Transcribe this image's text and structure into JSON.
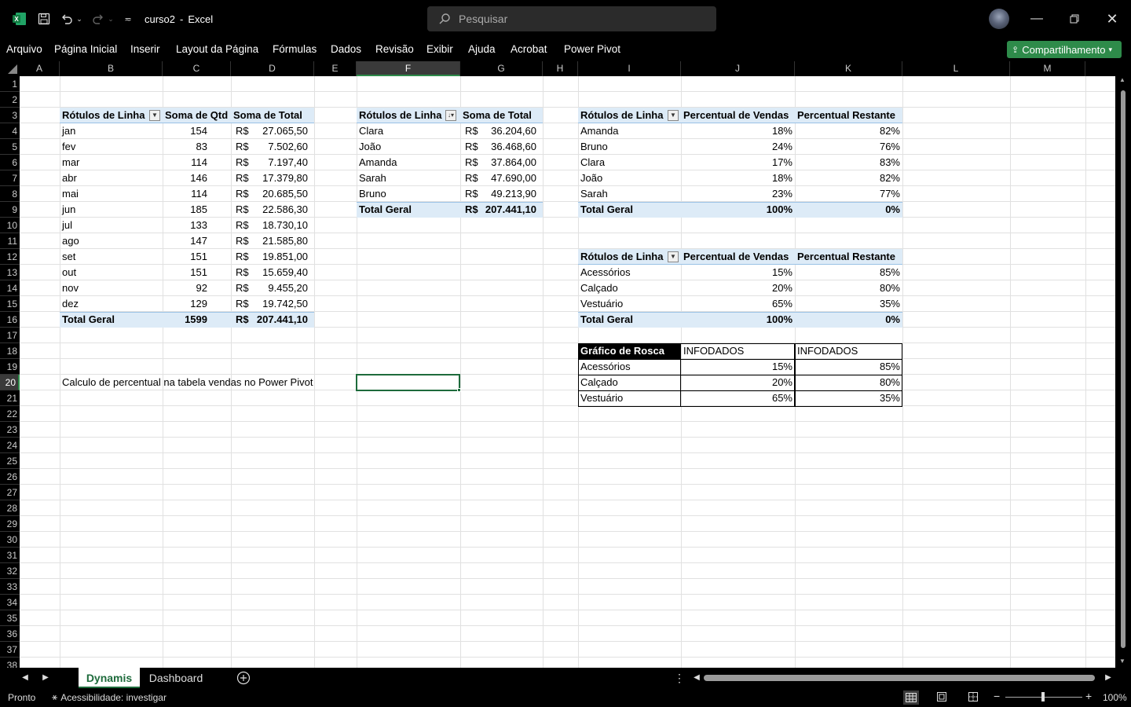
{
  "app": {
    "filename": "curso2",
    "separator": "-",
    "appname": "Excel"
  },
  "search": {
    "placeholder": "Pesquisar"
  },
  "menu": [
    "Arquivo",
    "Página Inicial",
    "Inserir",
    "Layout da Página",
    "Fórmulas",
    "Dados",
    "Revisão",
    "Exibir",
    "Ajuda",
    "Acrobat",
    "Power Pivot"
  ],
  "share_label": "Compartilhamento",
  "columns": [
    "A",
    "B",
    "C",
    "D",
    "E",
    "F",
    "G",
    "H",
    "I",
    "J",
    "K",
    "L",
    "M"
  ],
  "rows": [
    "1",
    "2",
    "3",
    "4",
    "5",
    "6",
    "7",
    "8",
    "9",
    "10",
    "11",
    "12",
    "13",
    "14",
    "15",
    "16",
    "17",
    "18",
    "19",
    "20",
    "21",
    "22",
    "23",
    "24",
    "25",
    "26",
    "27",
    "28",
    "29",
    "30",
    "31",
    "32",
    "33",
    "34",
    "35",
    "36",
    "37",
    "38"
  ],
  "pivot1": {
    "headers": [
      "Rótulos de Linha",
      "Soma de Qtd",
      "Soma de Total"
    ],
    "rows": [
      [
        "jan",
        "154",
        "R$",
        "27.065,50"
      ],
      [
        "fev",
        "83",
        "R$",
        "7.502,60"
      ],
      [
        "mar",
        "114",
        "R$",
        "7.197,40"
      ],
      [
        "abr",
        "146",
        "R$",
        "17.379,80"
      ],
      [
        "mai",
        "114",
        "R$",
        "20.685,50"
      ],
      [
        "jun",
        "185",
        "R$",
        "22.586,30"
      ],
      [
        "jul",
        "133",
        "R$",
        "18.730,10"
      ],
      [
        "ago",
        "147",
        "R$",
        "21.585,80"
      ],
      [
        "set",
        "151",
        "R$",
        "19.851,00"
      ],
      [
        "out",
        "151",
        "R$",
        "15.659,40"
      ],
      [
        "nov",
        "92",
        "R$",
        "9.455,20"
      ],
      [
        "dez",
        "129",
        "R$",
        "19.742,50"
      ]
    ],
    "total": [
      "Total Geral",
      "1599",
      "R$",
      "207.441,10"
    ]
  },
  "pivot2": {
    "headers": [
      "Rótulos de Linha",
      "Soma de Total"
    ],
    "rows": [
      [
        "Clara",
        "R$",
        "36.204,60"
      ],
      [
        "João",
        "R$",
        "36.468,60"
      ],
      [
        "Amanda",
        "R$",
        "37.864,00"
      ],
      [
        "Sarah",
        "R$",
        "47.690,00"
      ],
      [
        "Bruno",
        "R$",
        "49.213,90"
      ]
    ],
    "total": [
      "Total Geral",
      "R$",
      "207.441,10"
    ]
  },
  "pivot3": {
    "headers": [
      "Rótulos de Linha",
      "Percentual de Vendas",
      "Percentual Restante"
    ],
    "rows": [
      [
        "Amanda",
        "18%",
        "82%"
      ],
      [
        "Bruno",
        "24%",
        "76%"
      ],
      [
        "Clara",
        "17%",
        "83%"
      ],
      [
        "João",
        "18%",
        "82%"
      ],
      [
        "Sarah",
        "23%",
        "77%"
      ]
    ],
    "total": [
      "Total Geral",
      "100%",
      "0%"
    ]
  },
  "pivot4": {
    "headers": [
      "Rótulos de Linha",
      "Percentual de Vendas",
      "Percentual Restante"
    ],
    "rows": [
      [
        "Acessórios",
        "15%",
        "85%"
      ],
      [
        "Calçado",
        "20%",
        "80%"
      ],
      [
        "Vestuário",
        "65%",
        "35%"
      ]
    ],
    "total": [
      "Total Geral",
      "100%",
      "0%"
    ]
  },
  "donut_table": {
    "headers": [
      "Gráfico de Rosca",
      "INFODADOS",
      "INFODADOS"
    ],
    "rows": [
      [
        "Acessórios",
        "15%",
        "85%"
      ],
      [
        "Calçado",
        "20%",
        "80%"
      ],
      [
        "Vestuário",
        "65%",
        "35%"
      ]
    ]
  },
  "note": "Calculo de percentual na tabela vendas no Power Pivot",
  "sheets": [
    "Dynamis",
    "Dashboard"
  ],
  "status": {
    "ready": "Pronto",
    "accessibility": "Acessibilidade: investigar",
    "zoom": "100%"
  },
  "colors": {
    "accent": "#2e8b4a",
    "pivot_header": "#ddebf7"
  }
}
